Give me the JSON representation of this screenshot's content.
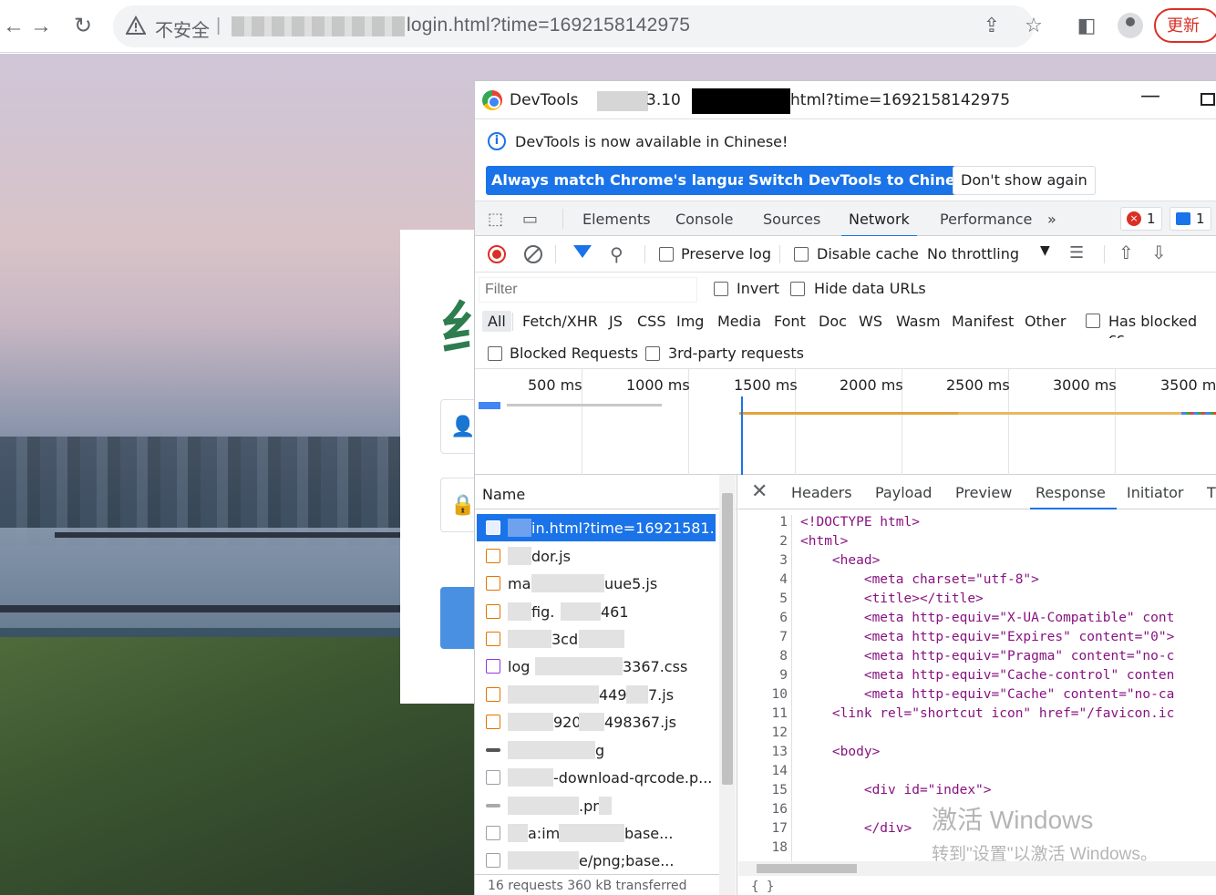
{
  "browser": {
    "back_icon": "arrow-left-icon",
    "forward_icon": "arrow-right-icon",
    "reload_icon": "reload-icon",
    "security_label": "不安全",
    "url_visible": "login.html?time=1692158142975",
    "update_label": "更新"
  },
  "login": {
    "logo_glyph": "纟"
  },
  "devtools": {
    "title": "DevTools",
    "title_mid": "3.10",
    "title_url": "html?time=1692158142975",
    "info": {
      "message": "DevTools is now available in Chinese!",
      "btn_match": "Always match Chrome's language",
      "btn_switch": "Switch DevTools to Chinese",
      "btn_dont": "Don't show again"
    },
    "tabs": [
      "Elements",
      "Console",
      "Sources",
      "Network",
      "Performance"
    ],
    "more_tabs": "»",
    "errors_count": "1",
    "messages_count": "1",
    "toolbar": {
      "preserve_log": "Preserve log",
      "disable_cache": "Disable cache",
      "throttling": "No throttling"
    },
    "filter": {
      "placeholder": "Filter",
      "invert": "Invert",
      "hide_data_urls": "Hide data URLs"
    },
    "types": [
      "All",
      "Fetch/XHR",
      "JS",
      "CSS",
      "Img",
      "Media",
      "Font",
      "Doc",
      "WS",
      "Wasm",
      "Manifest",
      "Other"
    ],
    "has_blocked": "Has blocked cc",
    "blocked_requests": "Blocked Requests",
    "third_party": "3rd-party requests",
    "timeline_ticks": [
      "500 ms",
      "1000 ms",
      "1500 ms",
      "2000 ms",
      "2500 ms",
      "3000 ms",
      "3500 m"
    ],
    "name_header": "Name",
    "requests": [
      "in.html?time=16921581...",
      "dor.js",
      "ma",
      "fig.",
      "3cd",
      "log",
      "449",
      "920",
      "g",
      "-download-qrcode.p...",
      ".pn",
      "a:im",
      "e/png;base..."
    ],
    "request_extra": [
      "",
      "",
      "uue5.js",
      "461",
      "",
      "3367.css",
      "7.js",
      "498367.js",
      "",
      "",
      "",
      "base...",
      ""
    ],
    "summary": "16 requests  360 kB transferred",
    "detail_tabs": [
      "Headers",
      "Payload",
      "Preview",
      "Response",
      "Initiator",
      "T"
    ],
    "active_detail_tab": "Response",
    "code_lines": [
      {
        "n": "1",
        "t": "<!DOCTYPE html>"
      },
      {
        "n": "2",
        "t": "<html>"
      },
      {
        "n": "3",
        "t": "    <head>"
      },
      {
        "n": "4",
        "t": "        <meta charset=\"utf-8\">"
      },
      {
        "n": "5",
        "t": "        <title></title>"
      },
      {
        "n": "6",
        "t": "        <meta http-equiv=\"X-UA-Compatible\" cont"
      },
      {
        "n": "7",
        "t": "        <meta http-equiv=\"Expires\" content=\"0\">"
      },
      {
        "n": "8",
        "t": "        <meta http-equiv=\"Pragma\" content=\"no-c"
      },
      {
        "n": "9",
        "t": "        <meta http-equiv=\"Cache-control\" conten"
      },
      {
        "n": "10",
        "t": "        <meta http-equiv=\"Cache\" content=\"no-ca"
      },
      {
        "n": "11",
        "t": "    <link rel=\"shortcut icon\" href=\"/favicon.ic"
      },
      {
        "n": "12",
        "t": ""
      },
      {
        "n": "13",
        "t": "    <body>"
      },
      {
        "n": "14",
        "t": ""
      },
      {
        "n": "15",
        "t": "        <div id=\"index\">"
      },
      {
        "n": "16",
        "t": ""
      },
      {
        "n": "17",
        "t": "        </div>"
      },
      {
        "n": "18",
        "t": ""
      }
    ],
    "braces": "{ }"
  },
  "watermark": {
    "line1": "激活 Windows",
    "line2": "转到\"设置\"以激活 Windows。"
  }
}
